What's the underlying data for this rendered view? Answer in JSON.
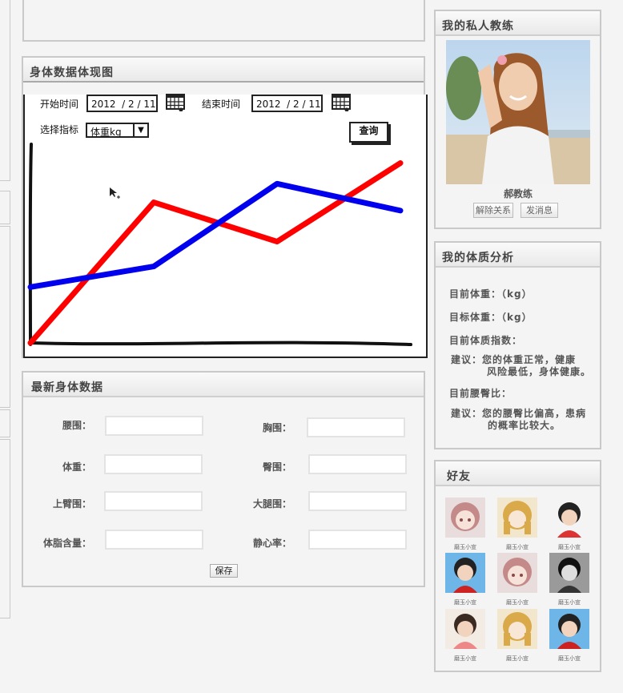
{
  "chart_panel": {
    "title": "身体数据体现图",
    "start_label": "开始时间",
    "start_value": "2012  / 2 / 11",
    "end_label": "结束时间",
    "end_value": "2012  / 2 / 11",
    "indicator_label": "选择指标",
    "indicator_value": "体重kg",
    "query_label": "查询"
  },
  "chart_data": {
    "type": "line",
    "title": "",
    "xlabel": "",
    "ylabel": "",
    "x": [
      0,
      1,
      2,
      3
    ],
    "series": [
      {
        "color": "#ff0000",
        "values": [
          0,
          68,
          49,
          87
        ]
      },
      {
        "color": "#0000ee",
        "values": [
          27,
          37,
          77,
          64
        ]
      }
    ],
    "ylim": [
      0,
      100
    ],
    "grid": false
  },
  "body_data": {
    "title": "最新身体数据",
    "fields": {
      "waist": "腰围：",
      "chest": "胸围：",
      "weight": "体重：",
      "hip": "臀围：",
      "upper_arm": "上臂围：",
      "thigh": "大腿围：",
      "body_fat": "体脂含量：",
      "resting_hr": "静心率："
    },
    "save_label": "保存"
  },
  "coach": {
    "title": "我的私人教练",
    "name": "郝教练",
    "unbind_label": "解除关系",
    "message_label": "发消息"
  },
  "analysis": {
    "title": "我的体质分析",
    "current_weight": "目前体重：（kg）",
    "target_weight": "目标体重：（kg）",
    "bmi": "目前体质指数：",
    "advice1_line1": "建议：您的体重正常，健康",
    "advice1_line2": "风险最低，身体健康。",
    "whr": "目前腰臀比：",
    "advice2_line1": "建议：您的腰臀比偏高，患病",
    "advice2_line2": "的概率比较大。"
  },
  "friends": {
    "title": "好友",
    "items": [
      {
        "name": "磨玉小宣"
      },
      {
        "name": "磨玉小宣"
      },
      {
        "name": "磨玉小宣"
      },
      {
        "name": "磨玉小宣"
      },
      {
        "name": "磨玉小宣"
      },
      {
        "name": "磨玉小宣"
      },
      {
        "name": "磨玉小宣"
      },
      {
        "name": "磨玉小宣"
      },
      {
        "name": "磨玉小宣"
      }
    ]
  }
}
